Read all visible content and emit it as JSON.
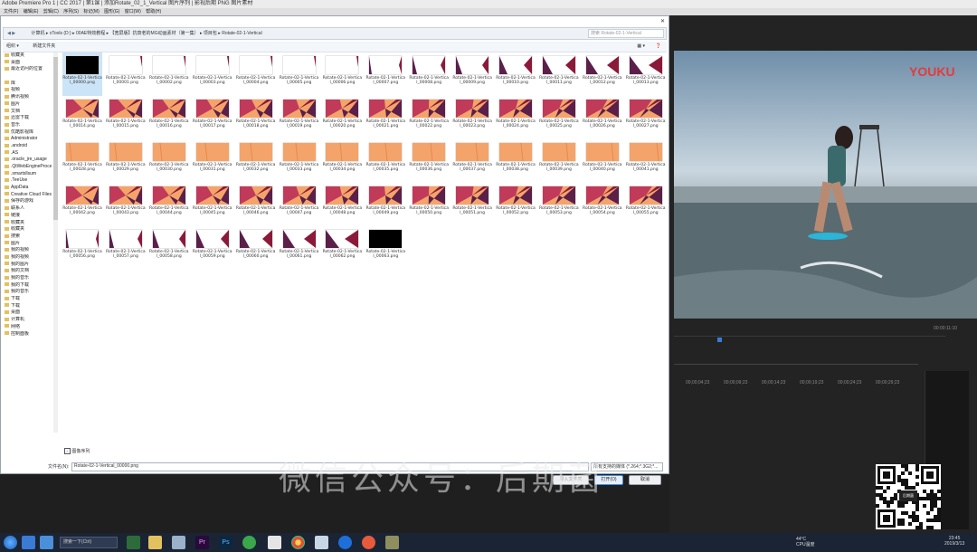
{
  "app": {
    "title": "Adobe Premiere Pro 1 | CC 2017 | 第1课 | 添加Rotate_02_1_Vertical 图片序列 | 影视后期 PNG 图片素材",
    "menu": [
      "文件(F)",
      "编辑(E)",
      "剪辑(C)",
      "序列(S)",
      "标记(M)",
      "图形(G)",
      "窗口(W)",
      "帮助(H)"
    ],
    "timecode_left": "00;00;00;00",
    "timecode_right": "00:00:11:10",
    "youku": "YOUKU",
    "track_times": [
      "00;00;00;00",
      "00;00;04;23",
      "00;00;09;23",
      "00;00;14;23",
      "00;00;19;23",
      "00;00;24;23",
      "00;00;29;23"
    ]
  },
  "dialog": {
    "breadcrumb": [
      "计算机",
      "xTools (D:)",
      "00AE特效教程",
      "【宽屏版】抗衰老的MG动画素材（第一集）",
      "项目包",
      "Rotate-02-1-Vertical"
    ],
    "search_placeholder": "搜索 Rotate-02-1-Vertical",
    "toolbar": {
      "organize": "组织 ▾",
      "new_folder": "新建文件夹"
    },
    "nav_items": [
      "收藏夹",
      "桌面",
      "最近访问的位置",
      "",
      "库",
      "视频",
      "腾讯视频",
      "图片",
      "文档",
      "迅雷下载",
      "音乐",
      "优酷影视库",
      "Administrator",
      ".android",
      ".AS",
      ".oracle_jre_usage",
      ".QtWebEngineProcess",
      ".smartsllsum",
      ".TeeUse",
      "AppData",
      "Creative Cloud Files",
      "保存的游戏",
      "联系人",
      "链接",
      "收藏夹",
      "收藏夹",
      "搜索",
      "图片",
      "我的视频",
      "我的视频",
      "我的图片",
      "我的文档",
      "我的音乐",
      "我的下载",
      "我的音乐",
      "下载",
      "下载",
      "桌面",
      "计算机",
      "网络",
      "控制面板"
    ],
    "file_prefix": "Rotate-02-1-Vertical_",
    "file_ext": ".png",
    "file_count": 64,
    "image_sequence_label": "图像序列",
    "filename_label": "文件名(N):",
    "filename_value": "Rotate-02-1-Vertical_00000.png",
    "filetype_value": "所有支持的媒体 (*.264;*.3G2;*...",
    "buttons": {
      "import_folder": "导入文件夹",
      "open": "打开(O)",
      "cancel": "取消"
    }
  },
  "overlay": {
    "watermark": "微信公众号：后期菌",
    "qr_label": "后期菌"
  },
  "taskbar": {
    "search": "搜索一下(Ctrl)",
    "weather": "44°C\nCPU温度",
    "time": "23:45",
    "date": "2019/3/13"
  },
  "colors": {
    "orange": "#f4a46a",
    "dark_red": "#8b1a3a",
    "purple": "#5b1f4a",
    "magenta": "#c13a5a"
  }
}
